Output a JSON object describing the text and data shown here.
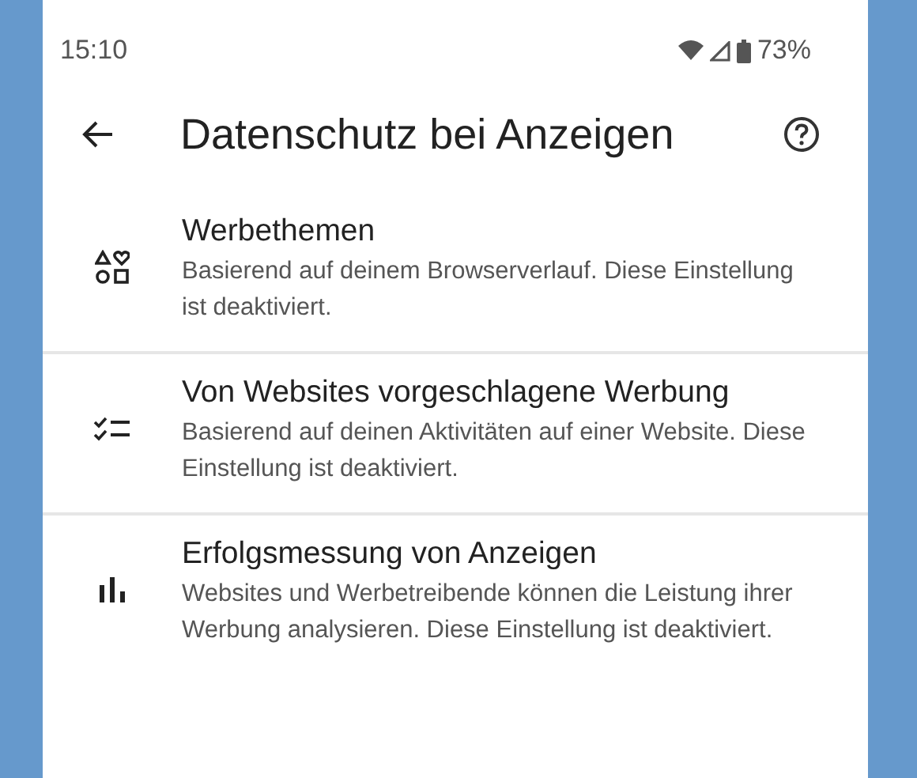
{
  "status_bar": {
    "time": "15:10",
    "battery": "73%"
  },
  "toolbar": {
    "title": "Datenschutz bei Anzeigen"
  },
  "items": [
    {
      "kind": "topics",
      "title": "Werbethemen",
      "description": "Basierend auf deinem Browserverlauf. Diese Einstellung ist deaktiviert."
    },
    {
      "kind": "suggested",
      "title": "Von Websites vorgeschlagene Werbung",
      "description": "Basierend auf deinen Aktivitäten auf einer Website. Diese Einstellung ist deaktiviert."
    },
    {
      "kind": "measurement",
      "title": "Erfolgsmessung von Anzeigen",
      "description": "Websites und Werbetreibende können die Leistung ihrer Werbung analysieren. Diese Einstellung ist deaktiviert."
    }
  ]
}
